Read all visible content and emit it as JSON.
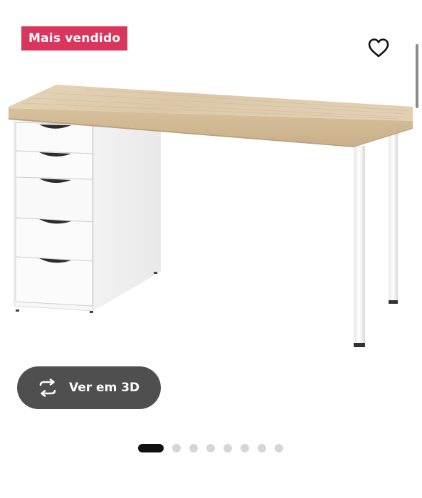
{
  "badge": {
    "label": "Mais vendido",
    "color": "#d9365e"
  },
  "favorite": {
    "icon": "heart-icon"
  },
  "product_image": {
    "subject": "desk with drawer unit",
    "colors": {
      "tabletop": "#e4d1b4",
      "frame": "#ffffff"
    }
  },
  "view3d": {
    "label": "Ver em 3D",
    "icon": "rotate-3d-icon"
  },
  "carousel": {
    "total_images": 8,
    "active_index": 0
  }
}
